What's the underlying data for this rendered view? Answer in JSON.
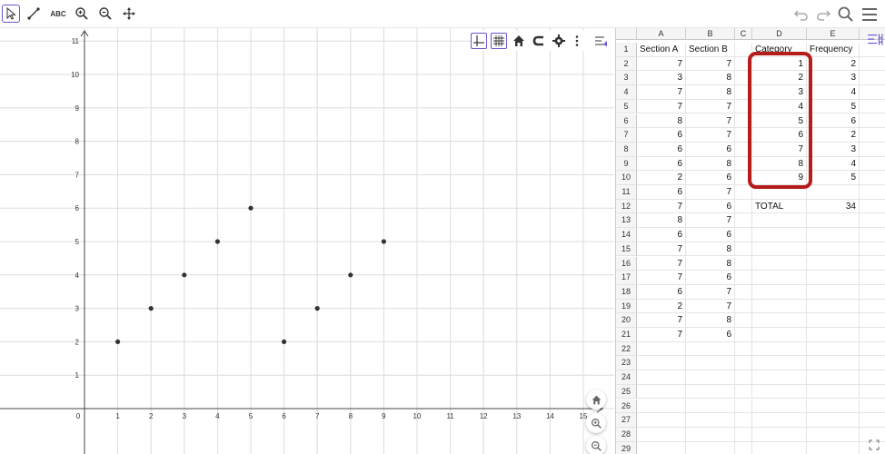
{
  "toolbar": {
    "left_tools": [
      {
        "name": "move-tool",
        "icon": "cursor-arrow-icon",
        "active": true
      },
      {
        "name": "segment-tool",
        "icon": "segment-icon",
        "active": false
      },
      {
        "name": "text-tool",
        "icon": "text-abc-icon",
        "label": "ABC",
        "active": false
      },
      {
        "name": "zoom-in-tool",
        "icon": "zoom-in-icon",
        "active": false
      },
      {
        "name": "zoom-out-tool",
        "icon": "zoom-out-icon",
        "active": false
      },
      {
        "name": "move-graphics-tool",
        "icon": "move-arrows-icon",
        "active": false
      }
    ],
    "right_tools": [
      {
        "name": "undo-button",
        "icon": "undo-icon"
      },
      {
        "name": "redo-button",
        "icon": "redo-icon"
      },
      {
        "name": "search-button",
        "icon": "search-icon"
      },
      {
        "name": "menu-button",
        "icon": "hamburger-menu-icon"
      }
    ],
    "accent": "#6557d2"
  },
  "graphics": {
    "x_ticks": [
      "0",
      "1",
      "2",
      "3",
      "4",
      "5",
      "6",
      "7",
      "8",
      "9",
      "10",
      "11",
      "12",
      "13",
      "14",
      "15"
    ],
    "y_ticks": [
      "1",
      "2",
      "3",
      "4",
      "5",
      "6",
      "7",
      "8",
      "9",
      "10",
      "11"
    ],
    "style_bar_icons": [
      "axes-icon",
      "grid-icon",
      "home-icon",
      "magnet-icon",
      "settings-gear-icon",
      "more-vertical-icon",
      "toggle-style-bar-icon"
    ],
    "corner_buttons": [
      "home-icon",
      "zoom-in-icon",
      "zoom-out-icon"
    ],
    "point_color": "#333333"
  },
  "chart_data": {
    "type": "scatter",
    "xlim": [
      0,
      15
    ],
    "ylim": [
      0,
      11
    ],
    "grid": true,
    "series": [
      {
        "x": [
          1,
          2,
          3,
          4,
          5,
          6,
          7,
          8,
          9
        ],
        "y": [
          2,
          3,
          4,
          5,
          6,
          2,
          3,
          4,
          5
        ]
      }
    ]
  },
  "sheet": {
    "columns": [
      "A",
      "B",
      "C",
      "D",
      "E"
    ],
    "rows": [
      [
        "Section A",
        "Section B",
        "",
        "Category",
        "Frequency"
      ],
      [
        "7",
        "7",
        "",
        "1",
        "2"
      ],
      [
        "3",
        "8",
        "",
        "2",
        "3"
      ],
      [
        "7",
        "8",
        "",
        "3",
        "4"
      ],
      [
        "7",
        "7",
        "",
        "4",
        "5"
      ],
      [
        "8",
        "7",
        "",
        "5",
        "6"
      ],
      [
        "6",
        "7",
        "",
        "6",
        "2"
      ],
      [
        "6",
        "6",
        "",
        "7",
        "3"
      ],
      [
        "6",
        "8",
        "",
        "8",
        "4"
      ],
      [
        "2",
        "6",
        "",
        "9",
        "5"
      ],
      [
        "6",
        "7",
        "",
        "",
        ""
      ],
      [
        "7",
        "6",
        "",
        "TOTAL",
        "34"
      ],
      [
        "8",
        "7",
        "",
        "",
        ""
      ],
      [
        "6",
        "6",
        "",
        "",
        ""
      ],
      [
        "7",
        "8",
        "",
        "",
        ""
      ],
      [
        "7",
        "8",
        "",
        "",
        ""
      ],
      [
        "7",
        "6",
        "",
        "",
        ""
      ],
      [
        "6",
        "7",
        "",
        "",
        ""
      ],
      [
        "2",
        "7",
        "",
        "",
        ""
      ],
      [
        "7",
        "8",
        "",
        "",
        ""
      ],
      [
        "7",
        "6",
        "",
        "",
        ""
      ],
      [
        "",
        "",
        "",
        "",
        ""
      ],
      [
        "",
        "",
        "",
        "",
        ""
      ],
      [
        "",
        "",
        "",
        "",
        ""
      ],
      [
        "",
        "",
        "",
        "",
        ""
      ],
      [
        "",
        "",
        "",
        "",
        ""
      ],
      [
        "",
        "",
        "",
        "",
        ""
      ],
      [
        "",
        "",
        "",
        "",
        ""
      ],
      [
        "",
        "",
        "",
        "",
        ""
      ]
    ],
    "highlight_color": "#b71c1c"
  }
}
